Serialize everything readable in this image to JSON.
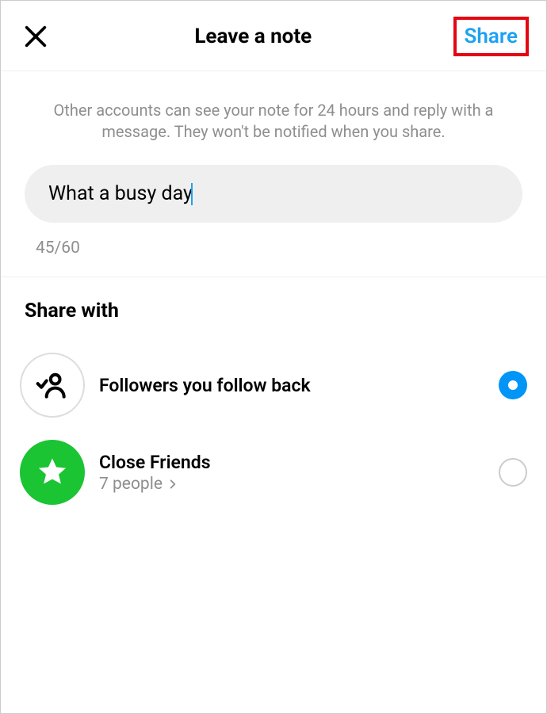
{
  "header": {
    "title": "Leave a note",
    "share_label": "Share"
  },
  "info_text": "Other accounts can see your note for 24 hours and reply with a message. They won't be notified when you share.",
  "note": {
    "value": "What a busy day",
    "counter": "45/60"
  },
  "share_with": {
    "title": "Share with",
    "options": [
      {
        "label": "Followers you follow back",
        "subtitle": "",
        "selected": true
      },
      {
        "label": "Close Friends",
        "subtitle": "7 people",
        "selected": false
      }
    ]
  }
}
